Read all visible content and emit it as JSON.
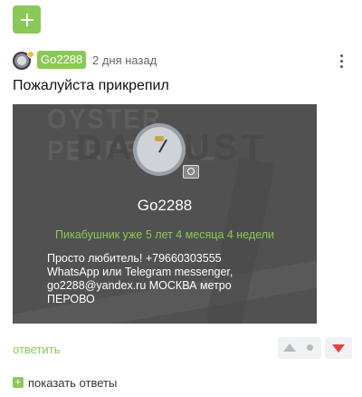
{
  "toolbar": {
    "add_icon": "plus-icon"
  },
  "comment": {
    "username": "Go2288",
    "time": "2 дня назад",
    "text": "Пожалуйста прикрепил",
    "more_icon": "vertical-dots-icon",
    "avatar_status_color": "#f2b53b"
  },
  "embed": {
    "background_text_line1": "OYSTER PERPETUAL",
    "background_text_line2": "DAYJUST",
    "name": "Go2288",
    "tenure": "Пикабушник уже 5 лет 4 месяца 4 недели",
    "about_lines": [
      "Просто любитель! +79660303555",
      "WhatsApp или Telegram messenger,",
      "go2288@yandex.ru МОСКВА метро",
      "ПЕРОВО"
    ],
    "camera_icon": "camera-icon"
  },
  "actions": {
    "reply_label": "ответить",
    "show_replies_label": "показать ответы",
    "upvote_icon": "arrow-up-icon",
    "downvote_icon": "arrow-down-icon"
  },
  "colors": {
    "accent_green": "#8ac858",
    "downvote_red": "#e14242"
  }
}
